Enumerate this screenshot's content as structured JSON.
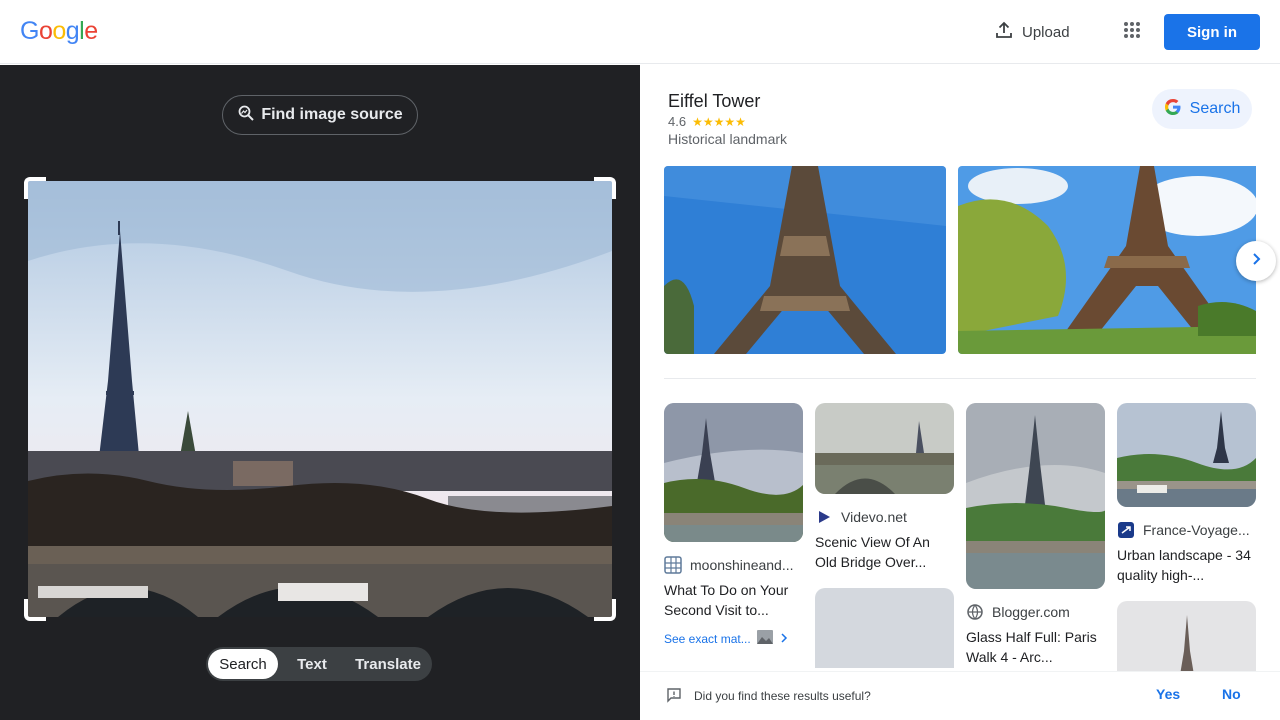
{
  "header": {
    "logo_letters": [
      "G",
      "o",
      "o",
      "g",
      "l",
      "e"
    ],
    "upload_label": "Upload",
    "signin_label": "Sign in"
  },
  "left_panel": {
    "find_source_label": "Find image source",
    "modes": [
      "Search",
      "Text",
      "Translate"
    ],
    "active_mode": "Search"
  },
  "knowledge_panel": {
    "title": "Eiffel Tower",
    "rating": "4.6",
    "stars": "★★★★★",
    "subtitle": "Historical landmark",
    "search_label": "Search"
  },
  "results": [
    {
      "source": "moonshineand...",
      "title": "What To Do on Your Second Visit to...",
      "see_exact": "See exact mat..."
    },
    {
      "source": "Videvo.net",
      "title": "Scenic View Of An Old Bridge Over..."
    },
    {
      "source": "Blogger.com",
      "title": "Glass Half Full: Paris Walk 4 - Arc..."
    },
    {
      "source": "France-Voyage...",
      "title": "Urban landscape - 34 quality high-..."
    }
  ],
  "feedback": {
    "question": "Did you find these results useful?",
    "yes_label": "Yes",
    "no_label": "No"
  },
  "colors": {
    "accent_blue": "#1a73e8",
    "dark_panel": "#202124",
    "star_yellow": "#fbbc04"
  }
}
